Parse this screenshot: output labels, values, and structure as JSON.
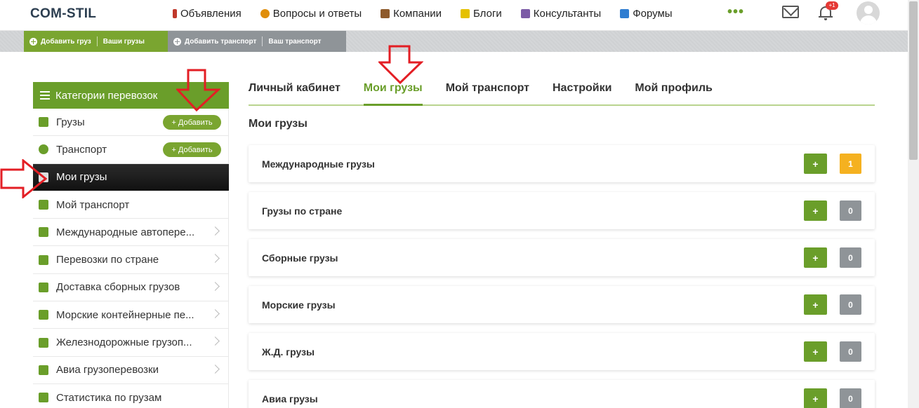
{
  "header": {
    "logo": "COM-STIL",
    "nav": [
      {
        "label": "Объявления",
        "icon": "ads-icon",
        "color": "#c0392b"
      },
      {
        "label": "Вопросы и ответы",
        "icon": "qa-icon",
        "color": "#e08e0b"
      },
      {
        "label": "Компании",
        "icon": "companies-icon",
        "color": "#8e5a2b"
      },
      {
        "label": "Блоги",
        "icon": "blogs-icon",
        "color": "#e5c100"
      },
      {
        "label": "Консультанты",
        "icon": "consultants-icon",
        "color": "#7b5aa6"
      },
      {
        "label": "Форумы",
        "icon": "forums-icon",
        "color": "#2e7dd1"
      }
    ],
    "more": "•••",
    "notifications_badge": "+1"
  },
  "action_strip": {
    "add_cargo": "Добавить груз",
    "my_cargo": "Ваши грузы",
    "add_transport": "Добавить транспорт",
    "my_transport": "Ваш транспорт"
  },
  "sidebar": {
    "title": "Категории перевозок",
    "items": [
      {
        "label": "Грузы",
        "icon": "box-icon",
        "add": "+ Добавить"
      },
      {
        "label": "Транспорт",
        "icon": "wheel-icon",
        "add": "+ Добавить"
      },
      {
        "label": "Мои грузы",
        "icon": "document-icon",
        "active": true
      },
      {
        "label": "Мой транспорт",
        "icon": "truck-icon"
      },
      {
        "label": "Международные автопере...",
        "icon": "bus-icon",
        "chevron": true
      },
      {
        "label": "Перевозки по стране",
        "icon": "van-icon",
        "chevron": true
      },
      {
        "label": "Доставка сборных грузов",
        "icon": "delivery-truck-icon",
        "chevron": true
      },
      {
        "label": "Морские контейнерные пе...",
        "icon": "ship-icon",
        "chevron": true
      },
      {
        "label": "Железнодорожные грузоп...",
        "icon": "train-icon",
        "chevron": true
      },
      {
        "label": "Авиа грузоперевозки",
        "icon": "plane-icon",
        "chevron": true
      },
      {
        "label": "Статистика по грузам",
        "icon": "stats-icon"
      }
    ]
  },
  "tabs": [
    {
      "label": "Личный кабинет"
    },
    {
      "label": "Мои грузы",
      "active": true
    },
    {
      "label": "Мой транспорт"
    },
    {
      "label": "Настройки"
    },
    {
      "label": "Мой профиль"
    }
  ],
  "main": {
    "title": "Мои грузы",
    "plus_label": "+",
    "cards": [
      {
        "title": "Международные грузы",
        "count": "1",
        "highlight": true
      },
      {
        "title": "Грузы по стране",
        "count": "0"
      },
      {
        "title": "Сборные грузы",
        "count": "0"
      },
      {
        "title": "Морские грузы",
        "count": "0"
      },
      {
        "title": "Ж.Д. грузы",
        "count": "0"
      },
      {
        "title": "Авиа грузы",
        "count": "0"
      }
    ]
  },
  "colors": {
    "accent_green": "#6a9e2a",
    "count_gray": "#8f9498",
    "count_highlight": "#f5b120",
    "annotation_red": "#e31e24"
  }
}
